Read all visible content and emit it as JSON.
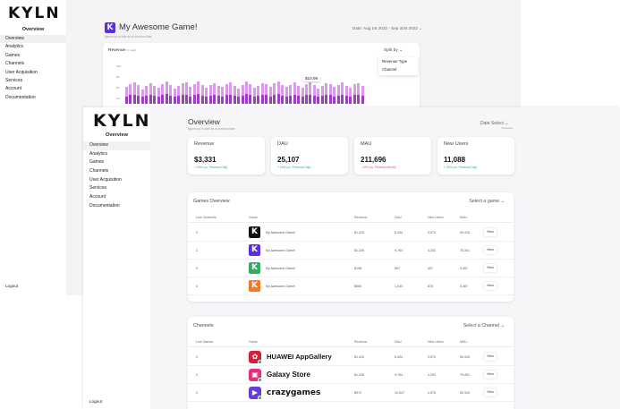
{
  "back_window": {
    "logo": "KYLN",
    "sidebar_heading": "Overview",
    "nav": [
      "Overview",
      "Analytics",
      "Games",
      "Channels",
      "User Acquisition",
      "Services",
      "Account",
      "Documentation"
    ],
    "logout": "Logout",
    "app_icon": "K",
    "title": "My Awesome Game!",
    "subtitle": "figures up to date as of previous date",
    "date_label": "Date: Aug 1st 2022 - Sep 31st 2022 ⌄",
    "revenue_card": {
      "title": "Revenue",
      "unit": "(in usd)",
      "split_label": "Split by ⌄",
      "split_options": [
        "Revenue Type",
        "Channel"
      ],
      "y_ticks": [
        "12K",
        "8K",
        "5K",
        "1K"
      ],
      "tooltip": "$10.99"
    },
    "chart_data": {
      "type": "bar",
      "stacked": true,
      "title": "Revenue",
      "bar_count": 60,
      "series": [
        {
          "name": "top",
          "color": "#d89ce6",
          "values": [
            0.62,
            0.72,
            0.8,
            0.7,
            0.55,
            0.68,
            0.78,
            0.66,
            0.6,
            0.74,
            0.82,
            0.7,
            0.58,
            0.66,
            0.76,
            0.8,
            0.64,
            0.72,
            0.84,
            0.7,
            0.6,
            0.7,
            0.78,
            0.68,
            0.62,
            0.74,
            0.8,
            0.66,
            0.58,
            0.7,
            0.82,
            0.74,
            0.6,
            0.68,
            0.78,
            0.72,
            0.64,
            0.76,
            0.84,
            0.7,
            0.62,
            0.7,
            0.8,
            0.68,
            0.6,
            0.74,
            0.8,
            0.7,
            0.58,
            0.66,
            0.78,
            0.74,
            0.62,
            0.7,
            0.8,
            0.68,
            0.6,
            0.72,
            0.78,
            0.66
          ]
        },
        {
          "name": "base",
          "color": "#9a3fc2",
          "values": [
            0.28,
            0.32,
            0.35,
            0.3,
            0.26,
            0.3,
            0.34,
            0.29,
            0.27,
            0.33,
            0.36,
            0.3,
            0.26,
            0.29,
            0.34,
            0.35,
            0.28,
            0.32,
            0.37,
            0.3,
            0.27,
            0.31,
            0.34,
            0.3,
            0.28,
            0.33,
            0.35,
            0.29,
            0.26,
            0.31,
            0.36,
            0.33,
            0.27,
            0.3,
            0.34,
            0.32,
            0.28,
            0.33,
            0.37,
            0.31,
            0.27,
            0.31,
            0.35,
            0.3,
            0.27,
            0.33,
            0.35,
            0.31,
            0.26,
            0.29,
            0.34,
            0.33,
            0.28,
            0.31,
            0.35,
            0.3,
            0.27,
            0.32,
            0.34,
            0.29
          ]
        }
      ]
    }
  },
  "front_window": {
    "logo": "KYLN",
    "sidebar_heading": "Overview",
    "nav": [
      "Overview",
      "Analytics",
      "Games",
      "Channels",
      "User Acquisition",
      "Services",
      "Account",
      "Documentation"
    ],
    "logout": "Logout",
    "title": "Overview",
    "subtitle": "figures up to date as of previous date",
    "date_select": "Date Select ⌄",
    "date_sub": "Yesterday",
    "stats": [
      {
        "label": "Revenue",
        "value": "$3,331",
        "change": "+ 15% (vs. Previous Day)",
        "trend": "up"
      },
      {
        "label": "DAU",
        "value": "25,107",
        "change": "+ 15% (vs. Previous Day)",
        "trend": "up"
      },
      {
        "label": "MAU",
        "value": "211,696",
        "change": "- 10% (vs. Previous Month)",
        "trend": "down"
      },
      {
        "label": "New Users",
        "value": "11,088",
        "change": "+ 25% (vs. Previous Day)",
        "trend": "up"
      }
    ],
    "games_overview": {
      "title": "Games Overview",
      "select": "Select a game ⌄",
      "columns": [
        "Live Channels",
        "Game",
        "Revenue",
        "DAU",
        "New Users",
        "MAU"
      ],
      "rows": [
        {
          "channels": "2",
          "name": "My Awesome Game!",
          "revenue": "$1,415",
          "dau": "5,404",
          "new": "3,574",
          "mau": "90,415",
          "icon_color": "#111111",
          "icon": "K"
        },
        {
          "channels": "2",
          "name": "My Awesome Game!",
          "revenue": "$1,226",
          "dau": "9,764",
          "new": "4,203",
          "mau": "75,341",
          "icon_color": "#5b2ee0",
          "icon": "K"
        },
        {
          "channels": "3",
          "name": "My Awesome Game!",
          "revenue": "$198",
          "dau": "657",
          "new": "457",
          "mau": "3,457",
          "icon_color": "#2fae5e",
          "icon": "K"
        },
        {
          "channels": "4",
          "name": "My Awesome Game!",
          "revenue": "$560",
          "dau": "1,043",
          "new": "875",
          "mau": "5,487",
          "icon_color": "#f07a2a",
          "icon": "K"
        }
      ],
      "view_label": "View"
    },
    "channels": {
      "title": "Channels",
      "select": "Select a Channel ⌄",
      "columns": [
        "Live Games",
        "Game",
        "Revenue",
        "DAU",
        "New Users",
        "MAU"
      ],
      "rows": [
        {
          "games": "2",
          "name": "HUAWEI AppGallery",
          "revenue": "$1,415",
          "dau": "5,404",
          "new": "3,574",
          "mau": "90,415",
          "icon_color": "#d61f3c",
          "icon": "✿",
          "style": "huawei"
        },
        {
          "games": "2",
          "name": "Galaxy Store",
          "revenue": "$1,226",
          "dau": "9,764",
          "new": "4,203",
          "mau": "75,451",
          "icon_color": "#e0307e",
          "icon": "▣",
          "style": "galaxy"
        },
        {
          "games": "2",
          "name": "crazygames",
          "revenue": "$972",
          "dau": "10,547",
          "new": "4,578",
          "mau": "90,315",
          "icon_color": "#6a3cd6",
          "icon": "▶",
          "style": "crazy"
        }
      ],
      "view_label": "View"
    }
  }
}
